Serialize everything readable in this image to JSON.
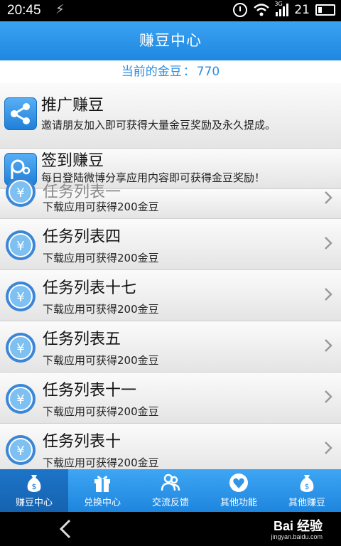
{
  "status_bar": {
    "time": "20:45",
    "network": "3G",
    "battery": "21"
  },
  "header": {
    "title": "赚豆中心"
  },
  "balance": {
    "label": "当前的金豆",
    "separator": "：",
    "value": "770"
  },
  "promos": [
    {
      "title": "推广赚豆",
      "subtitle": "邀请朋友加入即可获得大量金豆奖励及永久提成。",
      "icon": "share-icon"
    },
    {
      "title": "签到赚豆",
      "subtitle": "每日登陆微博分享应用内容即可获得金豆奖励！",
      "icon": "checkin-icon"
    }
  ],
  "tasks": [
    {
      "title": "任务列表一",
      "subtitle": "下载应用可获得200金豆",
      "icon": "coin-icon"
    },
    {
      "title": "任务列表四",
      "subtitle": "下载应用可获得200金豆",
      "icon": "coin-icon"
    },
    {
      "title": "任务列表十七",
      "subtitle": "下载应用可获得200金豆",
      "icon": "coin-icon"
    },
    {
      "title": "任务列表五",
      "subtitle": "下载应用可获得200金豆",
      "icon": "coin-icon"
    },
    {
      "title": "任务列表十一",
      "subtitle": "下载应用可获得200金豆",
      "icon": "coin-icon"
    },
    {
      "title": "任务列表十",
      "subtitle": "下载应用可获得200金豆",
      "icon": "coin-icon"
    }
  ],
  "tabs": [
    {
      "label": "赚豆中心",
      "icon": "money-bag-icon",
      "active": true
    },
    {
      "label": "兑换中心",
      "icon": "gift-icon",
      "active": false
    },
    {
      "label": "交流反馈",
      "icon": "users-icon",
      "active": false
    },
    {
      "label": "其他功能",
      "icon": "heart-icon",
      "active": false
    },
    {
      "label": "其他赚豆",
      "icon": "money-bag-icon",
      "active": false
    }
  ],
  "watermark": {
    "brand": "Bai 经验",
    "url": "jingyan.baidu.com"
  },
  "colors": {
    "primary": "#1f87e0",
    "active_tab": "#1563b0",
    "balance_text": "#2d8fe0"
  }
}
